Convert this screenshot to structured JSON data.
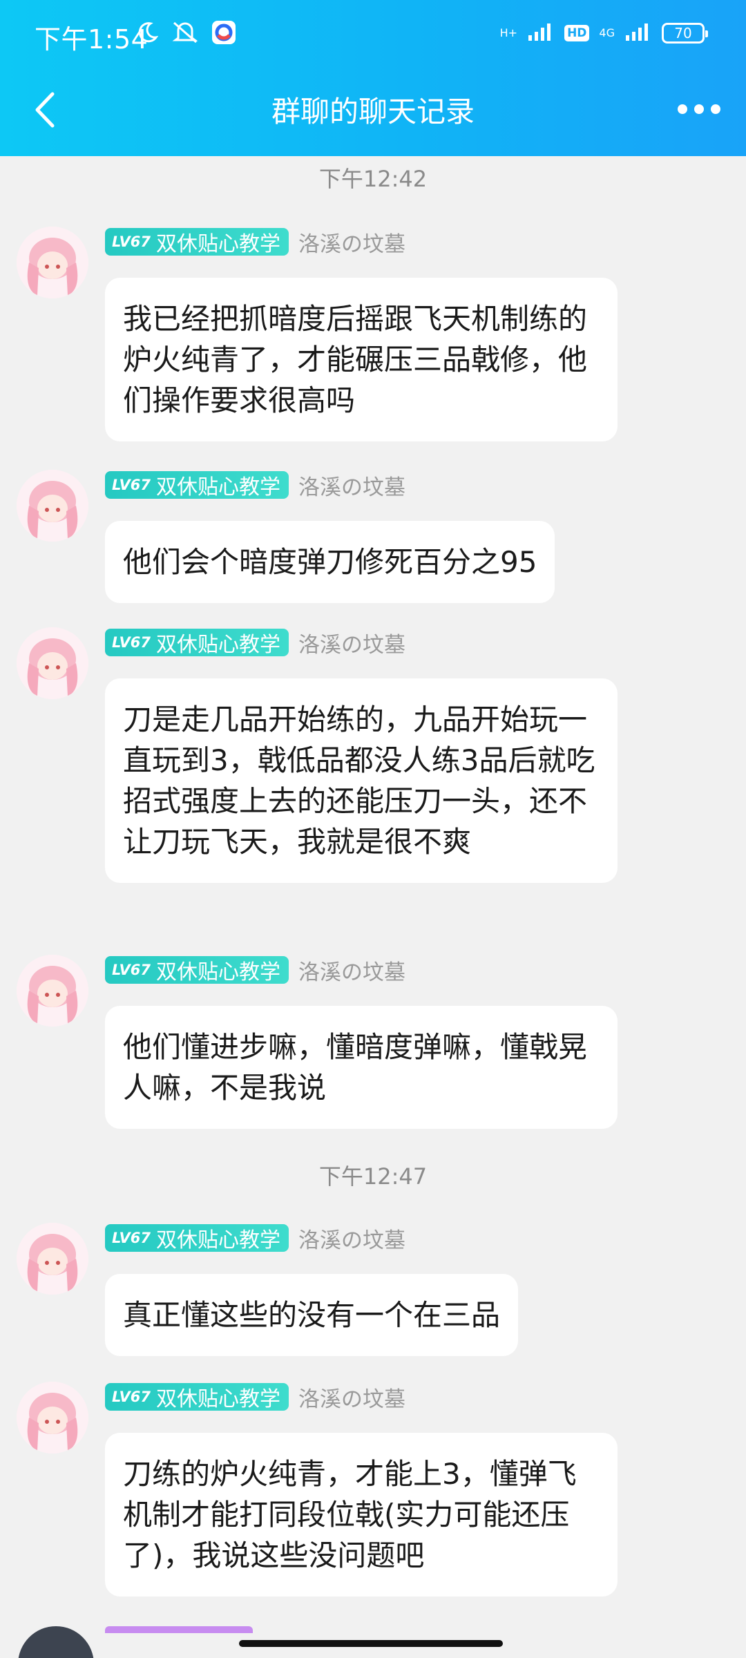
{
  "status_bar": {
    "time": "下午1:54",
    "net_type": "H+",
    "hd": "HD",
    "net_4g": "4G",
    "battery": "70"
  },
  "nav": {
    "title": "群聊的聊天记录"
  },
  "chat": {
    "timestamps": [
      "下午12:42",
      "下午12:47"
    ],
    "messages": [
      {
        "level": "LV67",
        "title": "双休贴心教学",
        "nick": "洛溪の坟墓",
        "text": "我已经把抓暗度后摇跟飞天机制练的炉火纯青了，才能碾压三品戟修，他们操作要求很高吗"
      },
      {
        "level": "LV67",
        "title": "双休贴心教学",
        "nick": "洛溪の坟墓",
        "text": "他们会个暗度弹刀修死百分之95"
      },
      {
        "level": "LV67",
        "title": "双休贴心教学",
        "nick": "洛溪の坟墓",
        "text": "刀是走几品开始练的，九品开始玩一直玩到3，戟低品都没人练3品后就吃招式强度上去的还能压刀一头，还不让刀玩飞天，我就是很不爽"
      },
      {
        "level": "LV67",
        "title": "双休贴心教学",
        "nick": "洛溪の坟墓",
        "text": "他们懂进步嘛，懂暗度弹嘛，懂戟晃人嘛，不是我说"
      },
      {
        "level": "LV67",
        "title": "双休贴心教学",
        "nick": "洛溪の坟墓",
        "text": "真正懂这些的没有一个在三品"
      },
      {
        "level": "LV67",
        "title": "双休贴心教学",
        "nick": "洛溪の坟墓",
        "text": "刀练的炉火纯青，才能上3，懂弹飞机制才能打同段位戟(实力可能还压了)，我说这些没问题吧"
      }
    ]
  },
  "colors": {
    "header_start": "#0dc8f5",
    "header_end": "#19a3f8",
    "badge": "#25c9c2",
    "background": "#f1f1f1"
  }
}
